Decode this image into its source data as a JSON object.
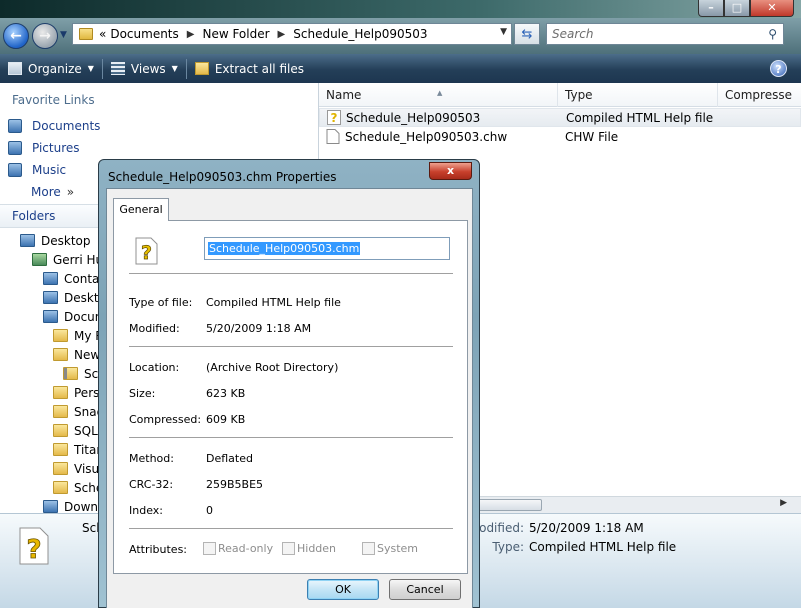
{
  "explorer": {
    "address": {
      "overflow": "«",
      "segments": [
        "Documents",
        "New Folder",
        "Schedule_Help090503"
      ]
    },
    "search": {
      "placeholder": "Search"
    },
    "toolbar": {
      "organize_label": "Organize",
      "views_label": "Views",
      "extract_label": "Extract all files"
    },
    "nav": {
      "favorite_links_heading": "Favorite Links",
      "favorites": [
        {
          "label": "Documents",
          "icon": "documents-icon"
        },
        {
          "label": "Pictures",
          "icon": "pictures-icon"
        },
        {
          "label": "Music",
          "icon": "music-icon"
        },
        {
          "label": "More",
          "icon": "double-chevron-icon"
        }
      ],
      "more_chevron": "»",
      "folders_heading": "Folders",
      "tree": [
        {
          "label": "Desktop"
        },
        {
          "label": "Gerri Hud"
        },
        {
          "label": "Contac"
        },
        {
          "label": "Deskto"
        },
        {
          "label": "Docum"
        },
        {
          "label": "My R"
        },
        {
          "label": "New"
        },
        {
          "label": "Sche"
        },
        {
          "label": "Perso"
        },
        {
          "label": "Snag"
        },
        {
          "label": "SQL S"
        },
        {
          "label": "Titan"
        },
        {
          "label": "Visua"
        },
        {
          "label": "Sche"
        },
        {
          "label": "Downl"
        }
      ]
    },
    "columns": [
      "Name",
      "Type",
      "Compresse"
    ],
    "files": [
      {
        "name": "Schedule_Help090503",
        "type": "Compiled HTML Help file"
      },
      {
        "name": "Schedule_Help090503.chw",
        "type": "CHW File"
      }
    ],
    "details": {
      "name": "Sche",
      "modified_label": "modified:",
      "modified_value": "5/20/2009 1:18 AM",
      "type_label": "Type:",
      "type_value": "Compiled HTML Help file"
    }
  },
  "dialog": {
    "title": "Schedule_Help090503.chm Properties",
    "close_glyph": "x",
    "tab_label": "General",
    "filename": "Schedule_Help090503.chm",
    "fields": {
      "type_label": "Type of file:",
      "type_value": "Compiled HTML Help file",
      "modified_label": "Modified:",
      "modified_value": "5/20/2009 1:18 AM",
      "location_label": "Location:",
      "location_value": "(Archive Root Directory)",
      "size_label": "Size:",
      "size_value": "623 KB",
      "compressed_label": "Compressed:",
      "compressed_value": "609 KB",
      "method_label": "Method:",
      "method_value": "Deflated",
      "crc_label": "CRC-32:",
      "crc_value": "259B5BE5",
      "index_label": "Index:",
      "index_value": "0",
      "attributes_label": "Attributes:"
    },
    "attributes": [
      {
        "label": "Read-only",
        "checked": false
      },
      {
        "label": "Hidden",
        "checked": false
      },
      {
        "label": "System",
        "checked": false
      }
    ],
    "ok_label": "OK",
    "cancel_label": "Cancel"
  }
}
